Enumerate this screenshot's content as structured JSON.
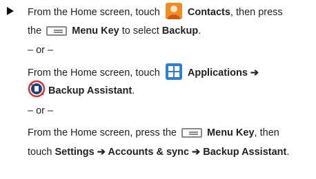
{
  "colors": {
    "apps_blue": "#2d7fd3",
    "contacts_orange": "#f28b22",
    "backup_red": "#d9342b"
  },
  "icons": {
    "bullet": "triangle-bullet",
    "contacts": "contacts-person-icon",
    "menu": "menu-key-icon",
    "applications": "applications-grid-icon",
    "backup": "backup-assistant-icon"
  },
  "step1": {
    "line1_prefix": "From the Home screen, touch",
    "contacts": "Contacts",
    "line1_suffix": ", then press",
    "line2_prefix": "the",
    "menu_key": "Menu Key",
    "line2_mid": " to select ",
    "backup": "Backup",
    "line2_end": "."
  },
  "or1": "– or –",
  "step2": {
    "line1_prefix": "From the Home screen, touch",
    "applications": "Applications ➔",
    "backup_assistant": "Backup Assistant",
    "end": "."
  },
  "or2": "– or –",
  "step3": {
    "line1_prefix": "From the Home screen, press the",
    "menu_key": "Menu Key",
    "line1_suffix": ", then",
    "line2_prefix": "touch ",
    "path": "Settings ➔ Accounts & sync ➔ Backup Assistant",
    "end": "."
  }
}
